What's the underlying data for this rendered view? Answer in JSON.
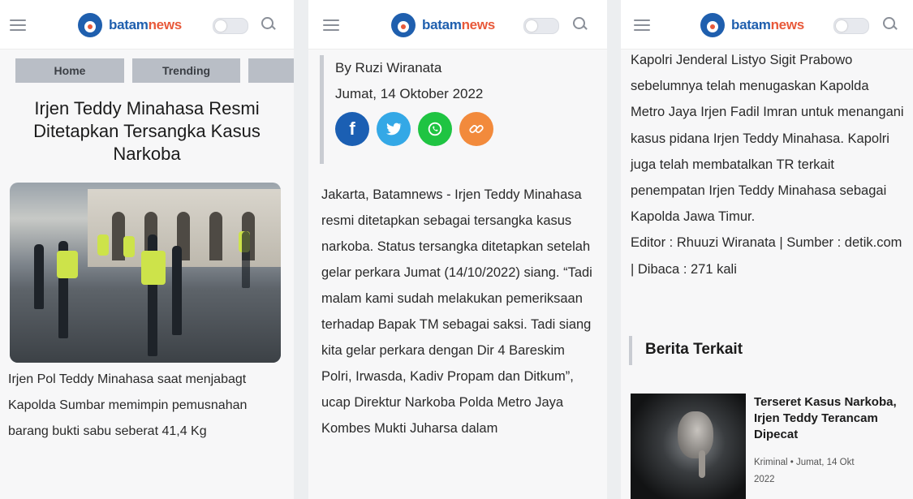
{
  "brand": {
    "name_a": "batam",
    "name_b": "news"
  },
  "colors": {
    "brand_blue": "#1f5fae",
    "brand_orange": "#e8593a",
    "nav_pill": "#b9bec6"
  },
  "header_icons": [
    "menu-icon",
    "toggle-switch",
    "search-icon"
  ],
  "panel1": {
    "nav": {
      "home": "Home",
      "trending": "Trending"
    },
    "headline": "Irjen Teddy Minahasa Resmi Ditetapkan Tersangka Kasus Narkoba",
    "caption": "Irjen Pol Teddy Minahasa saat menjabagt Kapolda Sumbar memimpin pemusnahan barang bukti sabu seberat 41,4 Kg"
  },
  "panel2": {
    "byline": "By Ruzi Wiranata",
    "date": "Jumat, 14 Oktober 2022",
    "share": {
      "facebook": "f",
      "twitter": "t",
      "whatsapp": "w",
      "link": "⛓"
    },
    "body": "Jakarta, Batamnews - Irjen Teddy Minahasa resmi ditetapkan sebagai tersangka kasus narkoba. Status tersangka ditetapkan setelah gelar perkara Jumat (14/10/2022) siang. “Tadi malam kami sudah melakukan pemeriksaan terhadap Bapak TM sebagai saksi. Tadi siang kita gelar perkara dengan Dir 4 Bareskim Polri, Irwasda, Kadiv Propam dan Ditkum”, ucap Direktur Narkoba Polda Metro Jaya Kombes Mukti Juharsa dalam"
  },
  "panel3": {
    "body": "Kapolri Jenderal Listyo Sigit Prabowo sebelumnya telah menugaskan Kapolda Metro Jaya Irjen Fadil Imran untuk menangani kasus pidana Irjen Teddy Minahasa. Kapolri juga telah membatalkan TR terkait penempatan Irjen Teddy Minahasa sebagai Kapolda Jawa Timur.",
    "editor_line": "Editor : Rhuuzi Wiranata | Sumber : detik.com | Dibaca : 271 kali",
    "related_title": "Berita Terkait",
    "related_item": {
      "headline": "Terseret Kasus Narkoba, Irjen Teddy Terancam Dipecat",
      "meta": "Kriminal • Jumat, 14 Okt 2022"
    }
  }
}
